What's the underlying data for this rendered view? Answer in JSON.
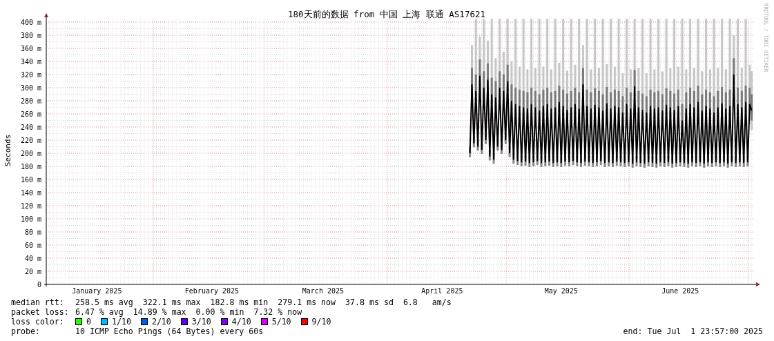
{
  "graph": {
    "credit": "RRDTOOL / TOBI OETIKER",
    "chart_data": {
      "type": "line",
      "grid": true,
      "title": "180天前的数据 from 中国 上海 联通 AS17621",
      "ylabel": "Seconds",
      "ylim": [
        0,
        405
      ],
      "yticks": [
        {
          "value": 0,
          "label": "0"
        },
        {
          "value": 20,
          "label": "20 m"
        },
        {
          "value": 40,
          "label": "40 m"
        },
        {
          "value": 60,
          "label": "60 m"
        },
        {
          "value": 80,
          "label": "80 m"
        },
        {
          "value": 100,
          "label": "100 m"
        },
        {
          "value": 120,
          "label": "120 m"
        },
        {
          "value": 140,
          "label": "140 m"
        },
        {
          "value": 160,
          "label": "160 m"
        },
        {
          "value": 180,
          "label": "180 m"
        },
        {
          "value": 200,
          "label": "200 m"
        },
        {
          "value": 220,
          "label": "220 m"
        },
        {
          "value": 240,
          "label": "240 m"
        },
        {
          "value": 260,
          "label": "260 m"
        },
        {
          "value": 280,
          "label": "280 m"
        },
        {
          "value": 300,
          "label": "300 m"
        },
        {
          "value": 320,
          "label": "320 m"
        },
        {
          "value": 340,
          "label": "340 m"
        },
        {
          "value": 360,
          "label": "360 m"
        },
        {
          "value": 380,
          "label": "380 m"
        },
        {
          "value": 400,
          "label": "400 m"
        }
      ],
      "categories": [
        null,
        null,
        null,
        null,
        null,
        null,
        null,
        null,
        null,
        null,
        null,
        null,
        null,
        null,
        null,
        null,
        null,
        null,
        null,
        null,
        null,
        null,
        null,
        null,
        null,
        "January 2025",
        null,
        null,
        null,
        null,
        null,
        null,
        null,
        null,
        null,
        null,
        null,
        null,
        null,
        null,
        null,
        null,
        null,
        null,
        null,
        null,
        null,
        null,
        null,
        null,
        null,
        null,
        null,
        null,
        null,
        null,
        null,
        null,
        null,
        null,
        null,
        null,
        null,
        null,
        null,
        null,
        null,
        null,
        null,
        null,
        null,
        null,
        null,
        null,
        null,
        null,
        null,
        null,
        null,
        null,
        null,
        null,
        null,
        "February 2025",
        null,
        null,
        null,
        null,
        null,
        null,
        null,
        null,
        null,
        null,
        null,
        null,
        null,
        null,
        null,
        null,
        null,
        null,
        null,
        null,
        null,
        null,
        null,
        null,
        null,
        null,
        null,
        null,
        null,
        null,
        null,
        null,
        null,
        null,
        null,
        null,
        null,
        null,
        null,
        null,
        null,
        null,
        null,
        null,
        null,
        null,
        null,
        null,
        null,
        null,
        null,
        null,
        null,
        null,
        null,
        "March 2025",
        null,
        null,
        null,
        null,
        null,
        null,
        null,
        null,
        null,
        null,
        null,
        null,
        null,
        null,
        null,
        null,
        null,
        null,
        null,
        null,
        null,
        null,
        null,
        null,
        null,
        null,
        null,
        null,
        null,
        null,
        null,
        null,
        null,
        null,
        null,
        null,
        null,
        null,
        null,
        null,
        null,
        null,
        null,
        null,
        null,
        null,
        null,
        null,
        null,
        null,
        null,
        null,
        null,
        null,
        null,
        null,
        null,
        null,
        null,
        "April 2025",
        null,
        null,
        null,
        null,
        null,
        null,
        null,
        null,
        null,
        null,
        null,
        null,
        null,
        null,
        null,
        null,
        null,
        null,
        null,
        null,
        null,
        null,
        null,
        null,
        null,
        null,
        null,
        null,
        null,
        null,
        null,
        null,
        null,
        null,
        null,
        null,
        null,
        null,
        null,
        null,
        null,
        null,
        null,
        null,
        null,
        null,
        null,
        null,
        null,
        null,
        null,
        null,
        null,
        null,
        null,
        null,
        null,
        null,
        null,
        "May 2025",
        null,
        null,
        null,
        null,
        null,
        null,
        null,
        null,
        null,
        null,
        null,
        null,
        null,
        null,
        null,
        null,
        null,
        null,
        null,
        null,
        null,
        null,
        null,
        null,
        null,
        null,
        null,
        null,
        null,
        null,
        null,
        null,
        null,
        null,
        null,
        null,
        null,
        null,
        null,
        null,
        null,
        null,
        null,
        null,
        null,
        null,
        null,
        null,
        null,
        null,
        null,
        null,
        null,
        null,
        null,
        null,
        null,
        null,
        null,
        "June 2025",
        null,
        null,
        null,
        null,
        null,
        null,
        null,
        null,
        null,
        null,
        null,
        null,
        null,
        null,
        null,
        null,
        null,
        null,
        null,
        null,
        null,
        null,
        null,
        null,
        null,
        null,
        null,
        null,
        null,
        null,
        null,
        null,
        null,
        null,
        null,
        null,
        null
      ],
      "series": [
        {
          "name": "median rtt:",
          "color": "#000000",
          "values": [
            null,
            null,
            null,
            null,
            null,
            null,
            null,
            null,
            null,
            null,
            null,
            null,
            null,
            null,
            null,
            null,
            null,
            null,
            null,
            null,
            null,
            null,
            null,
            null,
            null,
            null,
            null,
            null,
            null,
            null,
            null,
            null,
            null,
            null,
            null,
            null,
            null,
            null,
            null,
            null,
            null,
            null,
            null,
            null,
            null,
            null,
            null,
            null,
            null,
            null,
            null,
            null,
            null,
            null,
            null,
            null,
            null,
            null,
            null,
            null,
            null,
            null,
            null,
            null,
            null,
            null,
            null,
            null,
            null,
            null,
            null,
            null,
            null,
            null,
            null,
            null,
            null,
            null,
            null,
            null,
            null,
            null,
            null,
            null,
            null,
            null,
            null,
            null,
            null,
            null,
            null,
            null,
            null,
            null,
            null,
            null,
            null,
            null,
            null,
            null,
            null,
            null,
            null,
            null,
            null,
            null,
            null,
            null,
            null,
            null,
            null,
            null,
            null,
            null,
            null,
            null,
            null,
            null,
            null,
            null,
            null,
            null,
            null,
            null,
            null,
            null,
            null,
            null,
            null,
            null,
            null,
            null,
            null,
            null,
            null,
            null,
            null,
            null,
            null,
            null,
            null,
            null,
            null,
            null,
            null,
            null,
            null,
            null,
            null,
            null,
            null,
            null,
            null,
            null,
            null,
            null,
            null,
            null,
            null,
            null,
            null,
            null,
            null,
            null,
            null,
            null,
            null,
            null,
            null,
            null,
            null,
            null,
            null,
            null,
            null,
            null,
            null,
            null,
            null,
            null,
            null,
            null,
            null,
            null,
            null,
            null,
            null,
            null,
            null,
            null,
            null,
            null,
            null,
            null,
            null,
            null,
            null,
            null,
            null,
            null,
            null,
            null,
            null,
            null,
            null,
            null,
            null,
            null,
            null,
            null,
            null,
            null,
            null,
            200,
            305,
            215,
            295,
            210,
            318,
            205,
            300,
            220,
            312,
            195,
            290,
            190,
            285,
            210,
            300,
            205,
            295,
            220,
            310,
            200,
            280,
            190,
            275,
            188,
            272,
            186,
            270,
            187,
            268,
            185,
            275,
            186,
            270,
            188,
            265,
            185,
            272,
            186,
            275,
            187,
            268,
            185,
            270,
            186,
            278,
            185,
            272,
            187,
            266,
            186,
            270,
            188,
            275,
            186,
            268,
            185,
            305,
            187,
            272,
            186,
            268,
            185,
            274,
            186,
            270,
            188,
            265,
            185,
            276,
            186,
            268,
            185,
            272,
            187,
            270,
            186,
            262,
            185,
            275,
            186,
            268,
            184,
            302,
            186,
            270,
            185,
            266,
            184,
            262,
            186,
            272,
            185,
            268,
            184,
            270,
            186,
            265,
            185,
            274,
            186,
            270,
            184,
            266,
            185,
            272,
            186,
            250,
            185,
            268,
            184,
            275,
            186,
            270,
            185,
            278,
            186,
            265,
            184,
            272,
            186,
            268,
            185,
            262,
            186,
            270,
            185,
            276,
            186,
            268,
            184,
            272,
            186,
            320,
            185,
            275,
            186,
            270,
            185,
            278,
            186,
            275,
            265,
            null
          ]
        }
      ]
    }
  },
  "legend": {
    "median_rtt": {
      "values": [
        "258.5 ms avg",
        "322.1 ms max",
        "182.8 ms min",
        "279.1 ms now",
        "37.8 ms sd",
        "6.8   am/s"
      ]
    },
    "packet_loss": {
      "label": "packet loss:",
      "values": [
        "6.47 % avg",
        "14.89 % max",
        "0.00 % min",
        "7.32 % now"
      ]
    },
    "loss_color": {
      "label": "loss color:",
      "items": [
        {
          "label": "0",
          "color": "#26ff00"
        },
        {
          "label": "1/10",
          "color": "#00b8ff"
        },
        {
          "label": "2/10",
          "color": "#0059ff"
        },
        {
          "label": "3/10",
          "color": "#5e00ff"
        },
        {
          "label": "4/10",
          "color": "#7e00ff"
        },
        {
          "label": "5/10",
          "color": "#dd00ff"
        },
        {
          "label": "9/10",
          "color": "#ff0000"
        }
      ]
    },
    "probe": {
      "label": "probe:",
      "value": "10 ICMP Echo Pings (64 Bytes) every 60s"
    },
    "end": "end: Tue Jul  1 23:57:00 2025"
  }
}
